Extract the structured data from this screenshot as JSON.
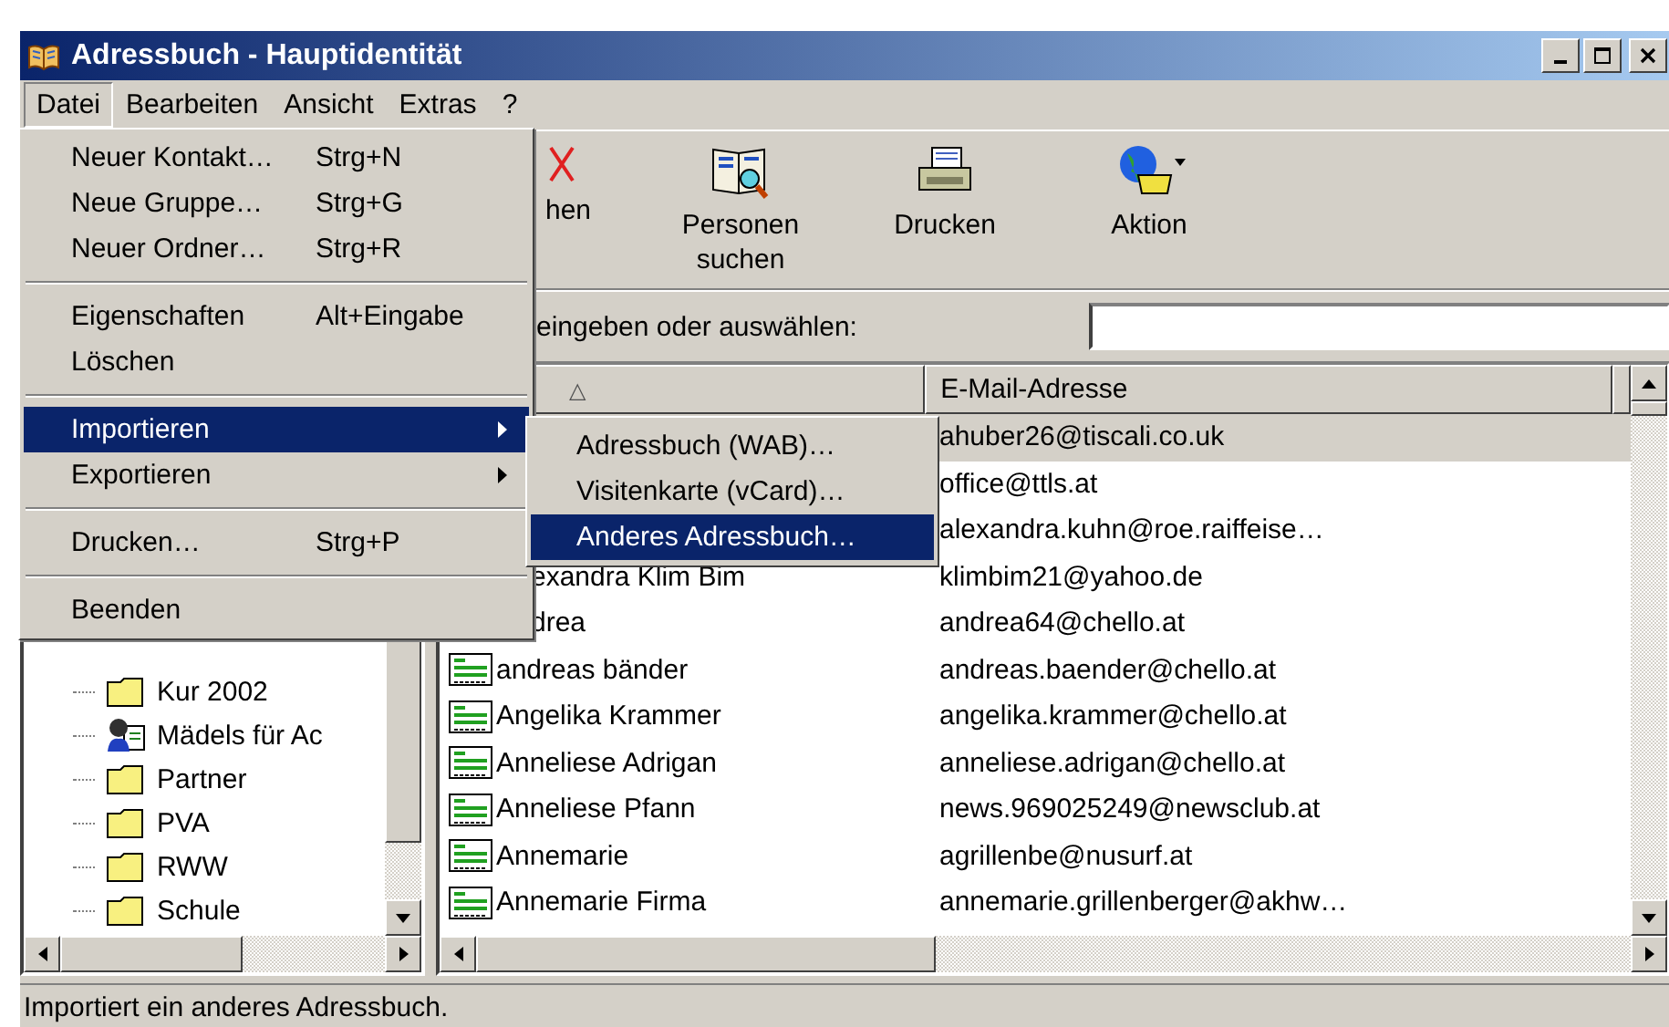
{
  "window": {
    "title": "Adressbuch - Hauptidentität"
  },
  "menu_bar": [
    {
      "label": "Datei",
      "selected": true
    },
    {
      "label": "Bearbeiten",
      "selected": false
    },
    {
      "label": "Ansicht",
      "selected": false
    },
    {
      "label": "Extras",
      "selected": false
    },
    {
      "label": "?",
      "selected": false
    }
  ],
  "file_menu": [
    {
      "kind": "item",
      "label": "Neuer Kontakt…",
      "shortcut": "Strg+N",
      "selected": false
    },
    {
      "kind": "item",
      "label": "Neue Gruppe…",
      "shortcut": "Strg+G",
      "selected": false
    },
    {
      "kind": "item",
      "label": "Neuer Ordner…",
      "shortcut": "Strg+R",
      "selected": false
    },
    {
      "kind": "separator"
    },
    {
      "kind": "item",
      "label": "Eigenschaften",
      "shortcut": "Alt+Eingabe",
      "selected": false
    },
    {
      "kind": "item",
      "label": "Löschen",
      "selected": false
    },
    {
      "kind": "separator"
    },
    {
      "kind": "submenu",
      "label": "Importieren",
      "selected": true
    },
    {
      "kind": "submenu",
      "label": "Exportieren",
      "selected": false
    },
    {
      "kind": "separator"
    },
    {
      "kind": "item",
      "label": "Drucken…",
      "shortcut": "Strg+P",
      "selected": false
    },
    {
      "kind": "separator"
    },
    {
      "kind": "item",
      "label": "Beenden",
      "selected": false
    }
  ],
  "import_submenu": [
    {
      "label": "Adressbuch (WAB)…",
      "selected": false
    },
    {
      "label": "Visitenkarte (vCard)…",
      "selected": false
    },
    {
      "label": "Anderes Adressbuch…",
      "selected": true
    }
  ],
  "toolbar": [
    {
      "kind": "delete",
      "label": "hen"
    },
    {
      "kind": "find",
      "label": "Personen suchen"
    },
    {
      "kind": "print",
      "label": "Drucken"
    },
    {
      "kind": "action",
      "label": "Aktion"
    }
  ],
  "search": {
    "label": "eingeben oder auswählen:"
  },
  "folders": [
    {
      "kind": "folder",
      "label": "Kur 2002"
    },
    {
      "kind": "group",
      "label": "Mädels für Ac"
    },
    {
      "kind": "folder",
      "label": "Partner"
    },
    {
      "kind": "folder",
      "label": "PVA"
    },
    {
      "kind": "folder",
      "label": "RWW"
    },
    {
      "kind": "folder",
      "label": "Schule"
    }
  ],
  "contacts": {
    "sort_mark": "△",
    "columns": [
      "E-Mail-Adresse"
    ],
    "rows": [
      {
        "email": "ahuber26@tiscali.co.uk",
        "selected": true
      },
      {
        "email": "office@ttls.at",
        "selected": false
      },
      {
        "email": "alexandra.kuhn@roe.raiffeise…",
        "selected": false
      },
      {
        "icon": false,
        "name": "exandra Klim Bim",
        "email": "klimbim21@yahoo.de",
        "selected": false
      },
      {
        "icon": false,
        "name": "drea",
        "email": "andrea64@chello.at",
        "selected": false
      },
      {
        "icon": true,
        "name": "andreas bänder",
        "email": "andreas.baender@chello.at",
        "selected": false
      },
      {
        "icon": true,
        "name": "Angelika Krammer",
        "email": "angelika.krammer@chello.at",
        "selected": false
      },
      {
        "icon": true,
        "name": "Anneliese Adrigan",
        "email": "anneliese.adrigan@chello.at",
        "selected": false
      },
      {
        "icon": true,
        "name": "Anneliese Pfann",
        "email": "news.969025249@newsclub.at",
        "selected": false
      },
      {
        "icon": true,
        "name": "Annemarie",
        "email": "agrillenbe@nusurf.at",
        "selected": false
      },
      {
        "icon": true,
        "name": "Annemarie Firma",
        "email": "annemarie.grillenberger@akhw…",
        "selected": false
      }
    ]
  },
  "status_bar": "Importiert ein anderes Adressbuch."
}
